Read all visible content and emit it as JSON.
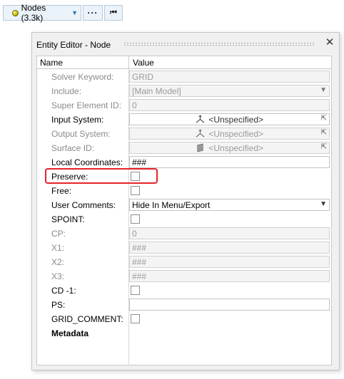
{
  "toolbar": {
    "nodes_label": "Nodes (3.3k)",
    "more_label": "···",
    "first_label": "⏮"
  },
  "dialog": {
    "title": "Entity Editor - Node",
    "close": "✕",
    "col_name": "Name",
    "col_value": "Value"
  },
  "rows": [
    {
      "label": "Solver Keyword:",
      "value": "GRID"
    },
    {
      "label": "Include:",
      "value": "[Main Model]"
    },
    {
      "label": "Super Element ID:",
      "value": "0"
    },
    {
      "label": "Input System:",
      "value": "<Unspecified>"
    },
    {
      "label": "Output System:",
      "value": "<Unspecified>"
    },
    {
      "label": "Surface ID:",
      "value": "<Unspecified>"
    },
    {
      "label": "Local Coordinates:",
      "value": "###"
    },
    {
      "label": "Preserve:"
    },
    {
      "label": "Free:"
    },
    {
      "label": "User Comments:",
      "value": "Hide In Menu/Export"
    },
    {
      "label": "SPOINT:"
    },
    {
      "label": "CP:",
      "value": "0"
    },
    {
      "label": "X1:",
      "value": "###"
    },
    {
      "label": "X2:",
      "value": "###"
    },
    {
      "label": "X3:",
      "value": "###"
    },
    {
      "label": "CD -1:"
    },
    {
      "label": "PS:",
      "value": ""
    },
    {
      "label": "GRID_COMMENT:"
    },
    {
      "label": "Metadata"
    }
  ],
  "colors": {
    "highlight": "#e5232b",
    "toolbar_bg": "#eaf2fa",
    "disabled_text": "#8a8a8a"
  }
}
